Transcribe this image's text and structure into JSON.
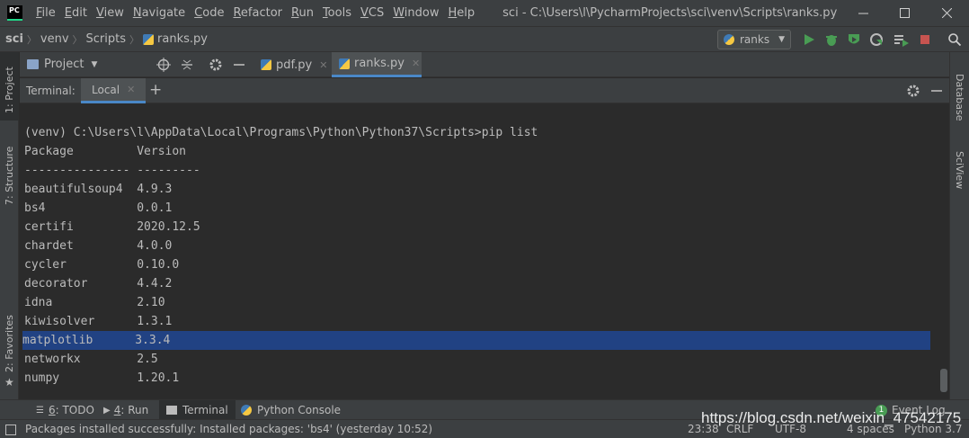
{
  "titlebar": {
    "logo": "PC",
    "menu": [
      {
        "first": "F",
        "rest": "ile"
      },
      {
        "first": "E",
        "rest": "dit"
      },
      {
        "first": "V",
        "rest": "iew"
      },
      {
        "first": "N",
        "rest": "avigate"
      },
      {
        "first": "C",
        "rest": "ode"
      },
      {
        "first": "R",
        "rest": "efactor"
      },
      {
        "first": "R",
        "rest": "un"
      },
      {
        "first": "T",
        "rest": "ools"
      },
      {
        "first": "V",
        "rest": "CS"
      },
      {
        "first": "W",
        "rest": "indow"
      },
      {
        "first": "H",
        "rest": "elp"
      }
    ],
    "path": "sci - C:\\Users\\l\\PycharmProjects\\sci\\venv\\Scripts\\ranks.py"
  },
  "navbar": {
    "crumbs": [
      "sci",
      "venv",
      "Scripts",
      "ranks.py"
    ],
    "run_config": "ranks"
  },
  "tabs": {
    "project_label": "Project",
    "files": [
      "pdf.py",
      "ranks.py"
    ]
  },
  "terminal": {
    "label": "Terminal:",
    "tab": "Local",
    "lines": [
      "(venv) C:\\Users\\l\\AppData\\Local\\Programs\\Python\\Python37\\Scripts>pip list",
      "Package         Version",
      "--------------- ---------",
      "beautifulsoup4  4.9.3",
      "bs4             0.0.1",
      "certifi         2020.12.5",
      "chardet         4.0.0",
      "cycler          0.10.0",
      "decorator       4.4.2",
      "idna            2.10",
      "kiwisolver      1.3.1",
      "matplotlib      3.3.4",
      "networkx        2.5",
      "numpy           1.20.1"
    ]
  },
  "side_tabs": {
    "left": [
      "1: Project",
      "7: Structure",
      "2: Favorites"
    ],
    "right": [
      "Database",
      "SciView"
    ]
  },
  "bottom_tabs": {
    "todo": {
      "num": "6",
      "label": ": TODO"
    },
    "run": {
      "num": "4",
      "label": ": Run"
    },
    "terminal": "Terminal",
    "python_console": "Python Console",
    "event_log": "Event Log",
    "event_count": "1"
  },
  "status": {
    "message": "Packages installed successfully: Installed packages: 'bs4' (yesterday 10:52)",
    "position": "23:38",
    "line_sep": "CRLF",
    "encoding": "UTF-8",
    "indent": "4 spaces",
    "interpreter": "Python 3.7"
  },
  "watermark": "https://blog.csdn.net/weixin_47542175"
}
